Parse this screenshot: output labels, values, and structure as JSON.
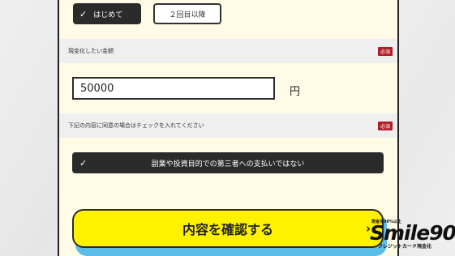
{
  "options": {
    "first_label": "はじめて",
    "second_label": "２回目以降",
    "selected": "first"
  },
  "amount_section": {
    "label": "現金化したい金額",
    "required_badge": "必須",
    "input_value": "50000",
    "unit": "円"
  },
  "agreement_section": {
    "label": "下記の内容に同意の場合はチェックを入れてください",
    "required_badge": "必須",
    "checkbox_label": "副業や投資目的での第三者への支払いではない",
    "checked": true
  },
  "submit": {
    "label": "内容を確認する"
  },
  "logo": {
    "tagline": "現金化90%以上",
    "name": "Smile90",
    "subtitle": "クレジットカード現金化"
  },
  "icons": {
    "check": "check-icon",
    "chevron": "chevron-right-icon"
  },
  "colors": {
    "accent_yellow": "#fff200",
    "dark": "#2b2b2b",
    "badge_red": "#b11e2a",
    "shadow_blue": "#5dbde9"
  }
}
